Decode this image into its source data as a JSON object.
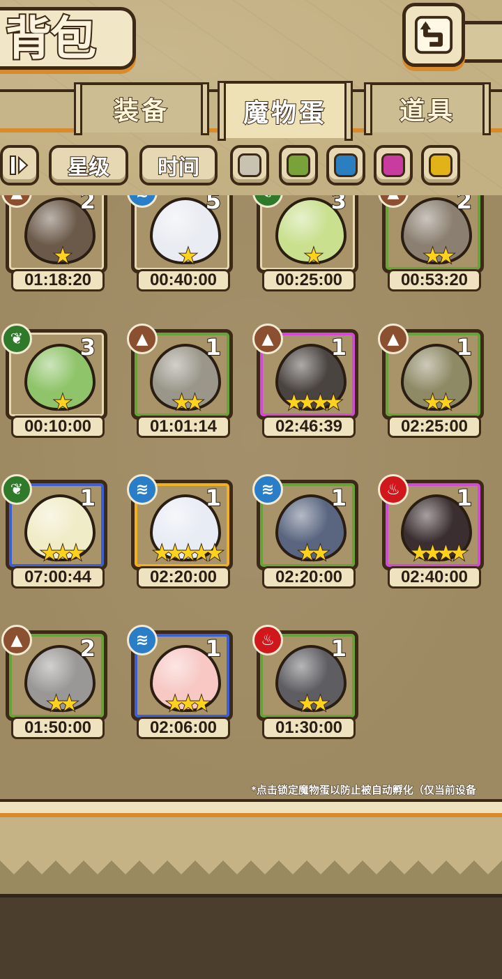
{
  "header": {
    "title": "背包",
    "back_icon": "return-arrow-icon"
  },
  "tabs": [
    {
      "label": "装备",
      "active": false
    },
    {
      "label": "魔物蛋",
      "active": true
    },
    {
      "label": "道具",
      "active": false
    }
  ],
  "filters": {
    "sort_icon": "sort-toggle-icon",
    "star_label": "星级",
    "time_label": "时间",
    "colors": [
      "#c8c2b0",
      "#79a23a",
      "#2b7fc0",
      "#c83ca0",
      "#e2b319"
    ]
  },
  "eggs": [
    {
      "count": "2",
      "stars": "★",
      "timer": "01:18:20",
      "element": "earth",
      "frame": "plain",
      "color": "#6b5a4a"
    },
    {
      "count": "5",
      "stars": "★",
      "timer": "00:40:00",
      "element": "water",
      "frame": "plain",
      "color": "#e9ecf2"
    },
    {
      "count": "3",
      "stars": "★",
      "timer": "00:25:00",
      "element": "nature",
      "frame": "plain",
      "color": "#c9e08f"
    },
    {
      "count": "2",
      "stars": "★★",
      "timer": "00:53:20",
      "element": "earth",
      "frame": "green",
      "color": "#8a7f70"
    },
    {
      "count": "3",
      "stars": "★",
      "timer": "00:10:00",
      "element": "nature",
      "frame": "plain",
      "color": "#8fc46a"
    },
    {
      "count": "1",
      "stars": "★★",
      "timer": "01:01:14",
      "element": "earth",
      "frame": "green",
      "color": "#9a978a"
    },
    {
      "count": "1",
      "stars": "★★★★",
      "timer": "02:46:39",
      "element": "earth",
      "frame": "purple",
      "color": "#4a4440"
    },
    {
      "count": "1",
      "stars": "★★",
      "timer": "02:25:00",
      "element": "earth",
      "frame": "green",
      "color": "#8e8a66"
    },
    {
      "count": "1",
      "stars": "★★★",
      "timer": "07:00:44",
      "element": "nature",
      "frame": "blue",
      "color": "#f0ecc8"
    },
    {
      "count": "1",
      "stars": "★★★★★",
      "timer": "02:20:00",
      "element": "water",
      "frame": "gold",
      "color": "#e8ecf4"
    },
    {
      "count": "1",
      "stars": "★★",
      "timer": "02:20:00",
      "element": "water",
      "frame": "green",
      "color": "#5a6680"
    },
    {
      "count": "1",
      "stars": "★★★★",
      "timer": "02:40:00",
      "element": "fire",
      "frame": "purple",
      "color": "#3a2e30"
    },
    {
      "count": "2",
      "stars": "★★",
      "timer": "01:50:00",
      "element": "earth",
      "frame": "green",
      "color": "#9a9896"
    },
    {
      "count": "1",
      "stars": "★★★",
      "timer": "02:06:00",
      "element": "water",
      "frame": "blue",
      "color": "#f7c8c4"
    },
    {
      "count": "1",
      "stars": "★★",
      "timer": "01:30:00",
      "element": "fire",
      "frame": "green",
      "color": "#5e5e62"
    }
  ],
  "footer_note": "*点击锁定魔物蛋以防止被自动孵化（仅当前设备"
}
